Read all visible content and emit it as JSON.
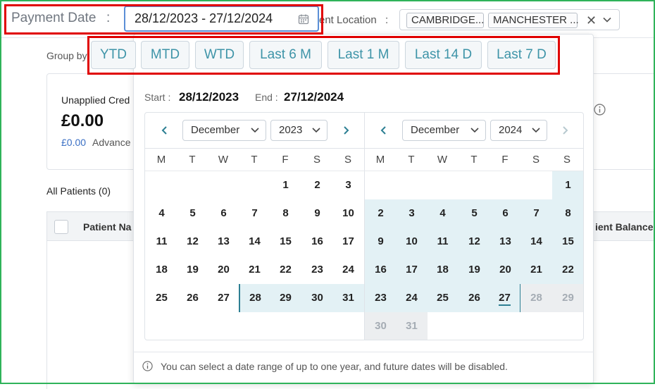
{
  "filter": {
    "payment_date_label": "Payment Date",
    "colon": ":",
    "date_range_value": "28/12/2023 - 27/12/2024",
    "location_label_partial": "ent Location",
    "location_chips": [
      "CAMBRIDGE...",
      "MANCHESTER ..."
    ],
    "clear_symbol": "✕"
  },
  "background": {
    "group_by_label": "Group by",
    "unapplied_label": "Unapplied Cred",
    "unapplied_value": "£0.00",
    "advance_amount": "£0.00",
    "advance_label": "Advance",
    "all_patients": "All Patients (0)",
    "col_patient_name": "Patient Na",
    "col_patient_balance": "ient Balance"
  },
  "presets": [
    "YTD",
    "MTD",
    "WTD",
    "Last 6 M",
    "Last 1 M",
    "Last 14 D",
    "Last 7 D"
  ],
  "range": {
    "start_label": "Start :",
    "start_value": "28/12/2023",
    "end_label": "End :",
    "end_value": "27/12/2024"
  },
  "calendars": {
    "left": {
      "month": "December",
      "year": "2023"
    },
    "right": {
      "month": "December",
      "year": "2024"
    },
    "weekdays": [
      "M",
      "T",
      "W",
      "T",
      "F",
      "S",
      "S"
    ]
  },
  "footer_note": "You can select a date range of up to one year, and future dates will be disabled.",
  "colors": {
    "accent": "#2d7f93",
    "range_fill": "#e3f1f5",
    "highlight_border": "#e00000",
    "frame": "#2fb35a",
    "input_focus": "#5b8fd6"
  }
}
